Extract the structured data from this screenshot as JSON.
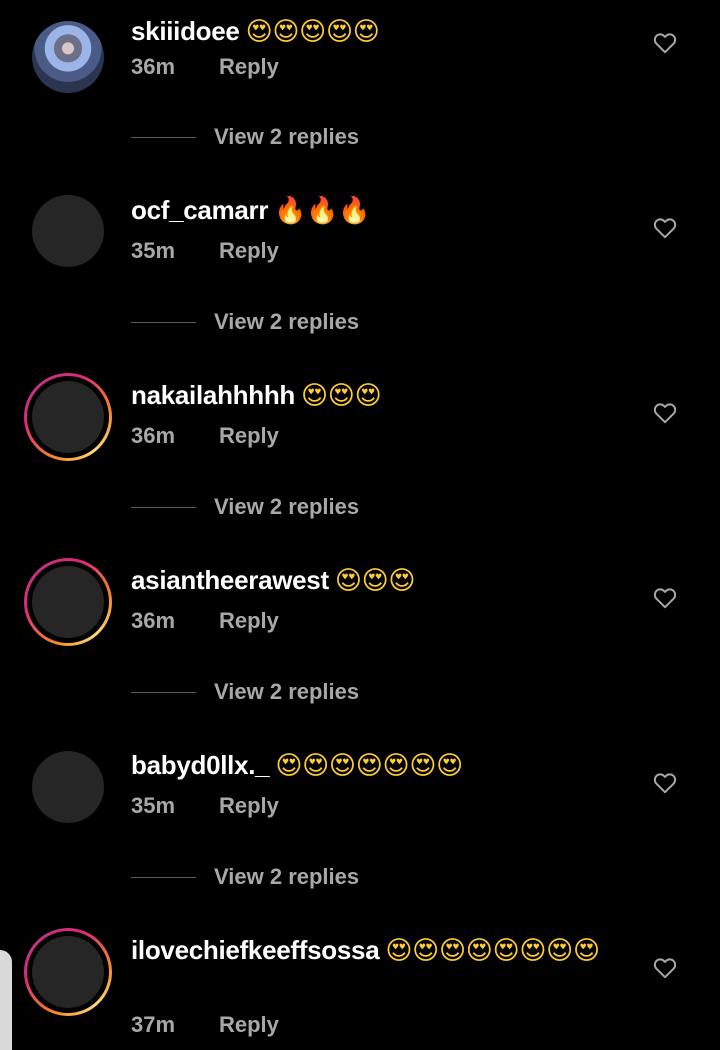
{
  "comments": [
    {
      "username": "skiiidoee",
      "emoji": "😍😍😍😍😍",
      "emoji_type": "heart-eyes",
      "time": "36m",
      "reply_label": "Reply",
      "view_replies_label": "View 2 replies",
      "avatar": "photo",
      "story_ring": false
    },
    {
      "username": "ocf_camarr",
      "emoji": "🔥🔥🔥",
      "emoji_type": "fire",
      "time": "35m",
      "reply_label": "Reply",
      "view_replies_label": "View 2 replies",
      "avatar": "placeholder",
      "story_ring": false
    },
    {
      "username": "nakailahhhhh",
      "emoji": "😍😍😍",
      "emoji_type": "heart-eyes",
      "time": "36m",
      "reply_label": "Reply",
      "view_replies_label": "View 2 replies",
      "avatar": "placeholder",
      "story_ring": true
    },
    {
      "username": "asiantheerawest",
      "emoji": "😍😍😍",
      "emoji_type": "heart-eyes",
      "time": "36m",
      "reply_label": "Reply",
      "view_replies_label": "View 2 replies",
      "avatar": "placeholder",
      "story_ring": true
    },
    {
      "username": "babyd0llx._",
      "emoji": "😍😍😍😍😍😍😍",
      "emoji_type": "heart-eyes",
      "time": "35m",
      "reply_label": "Reply",
      "view_replies_label": "View 2 replies",
      "avatar": "placeholder",
      "story_ring": false
    },
    {
      "username": "ilovechiefkeeffsossa",
      "emoji": "😍😍😍😍😍😍😍😍",
      "emoji_type": "heart-eyes",
      "time": "37m",
      "reply_label": "Reply",
      "view_replies_label": "",
      "avatar": "placeholder",
      "story_ring": true
    }
  ],
  "colors": {
    "background": "#000000",
    "text_primary": "#ffffff",
    "text_secondary": "#a8a8a8",
    "avatar_placeholder": "#262626"
  },
  "icons": {
    "like": "heart-outline-icon"
  }
}
